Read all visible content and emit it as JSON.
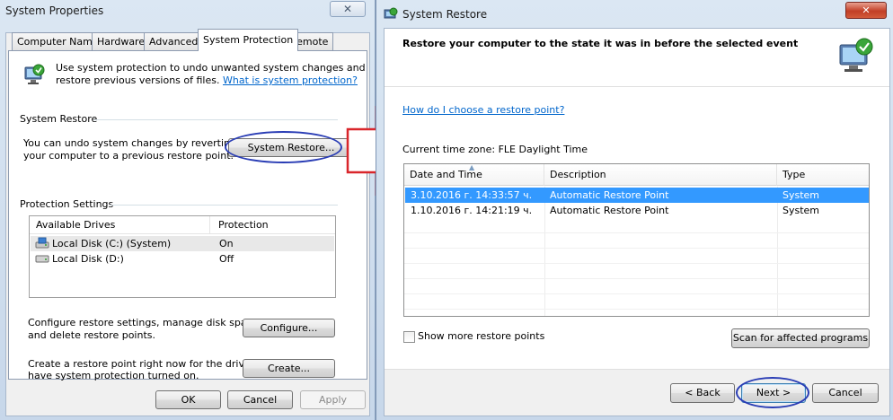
{
  "system_properties": {
    "title": "System Properties",
    "tabs": [
      "Computer Name",
      "Hardware",
      "Advanced",
      "System Protection",
      "Remote"
    ],
    "active_tab": "System Protection",
    "intro_line1": "Use system protection to undo unwanted system changes and",
    "intro_line2": "restore previous versions of files.",
    "intro_link": "What is system protection?",
    "restore_group_title": "System Restore",
    "restore_text_line1": "You can undo system changes by reverting",
    "restore_text_line2": "your computer to a previous restore point.",
    "restore_button": "System Restore...",
    "protection_group_title": "Protection Settings",
    "drives_header": [
      "Available Drives",
      "Protection"
    ],
    "drives": [
      {
        "name": "Local Disk (C:) (System)",
        "protection": "On",
        "icon": "system-drive-icon"
      },
      {
        "name": "Local Disk (D:)",
        "protection": "Off",
        "icon": "drive-icon"
      }
    ],
    "configure_text_line1": "Configure restore settings, manage disk space,",
    "configure_text_line2": "and delete restore points.",
    "configure_button": "Configure...",
    "create_text_line1": "Create a restore point right now for the drives that",
    "create_text_line2": "have system protection turned on.",
    "create_button": "Create...",
    "ok_button": "OK",
    "cancel_button": "Cancel",
    "apply_button": "Apply",
    "close_icon": "close-icon"
  },
  "system_restore": {
    "title": "System Restore",
    "heading": "Restore your computer to the state it was in before the selected event",
    "help_link": "How do I choose a restore point?",
    "timezone": "Current time zone: FLE Daylight Time",
    "columns": [
      "Date and Time",
      "Description",
      "Type"
    ],
    "restore_points": [
      {
        "date": "3.10.2016 г. 14:33:57 ч.",
        "description": "Automatic Restore Point",
        "type": "System"
      },
      {
        "date": "1.10.2016 г. 14:21:19 ч.",
        "description": "Automatic Restore Point",
        "type": "System"
      }
    ],
    "show_more_label": "Show more restore points",
    "show_more_checked": false,
    "scan_button": "Scan for affected programs",
    "back_button": "< Back",
    "next_button": "Next >",
    "cancel_button": "Cancel",
    "close_icon": "close-icon",
    "accent_color": "#3399ff"
  }
}
